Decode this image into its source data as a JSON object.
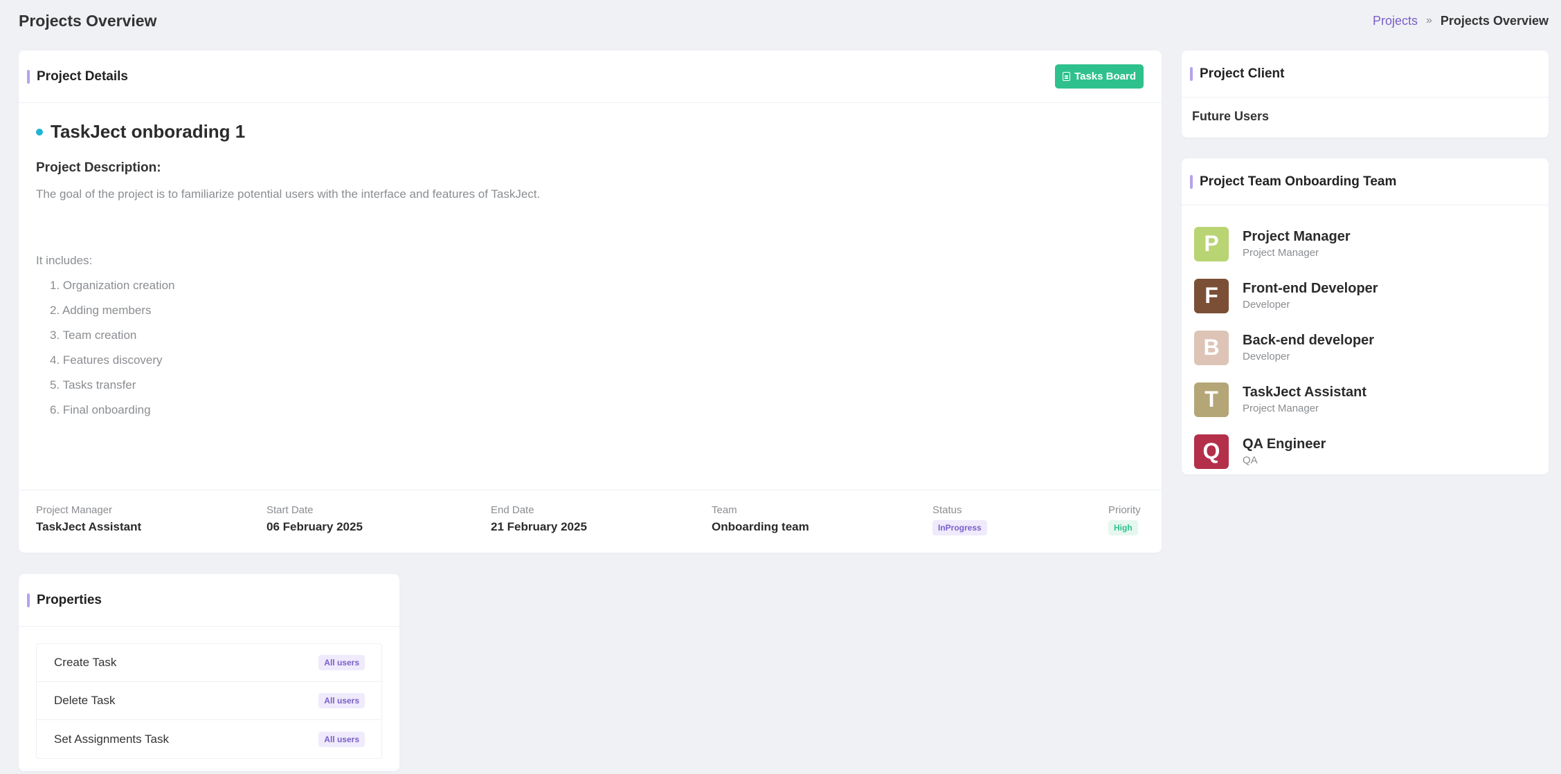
{
  "page": {
    "title": "Projects Overview"
  },
  "breadcrumb": {
    "link": "Projects",
    "separator": "»",
    "current": "Projects Overview"
  },
  "details": {
    "card_title": "Project Details",
    "tasks_board_label": "Tasks Board",
    "project_name": "TaskJect onborading 1",
    "description_label": "Project Description:",
    "description": "The goal of the project is to familiarize potential users with the interface and features of TaskJect.",
    "includes_label": "It includes:",
    "includes": [
      "1. Organization creation",
      "2. Adding members",
      "3. Team creation",
      "4. Features discovery",
      "5. Tasks transfer",
      "6. Final onboarding"
    ],
    "meta": {
      "manager_label": "Project Manager",
      "manager": "TaskJect Assistant",
      "start_label": "Start Date",
      "start": "06 February 2025",
      "end_label": "End Date",
      "end": "21 February 2025",
      "team_label": "Team",
      "team": "Onboarding team",
      "status_label": "Status",
      "status": "InProgress",
      "priority_label": "Priority",
      "priority": "High"
    }
  },
  "properties": {
    "card_title": "Properties",
    "rows": [
      {
        "name": "Create Task",
        "scope": "All users"
      },
      {
        "name": "Delete Task",
        "scope": "All users"
      },
      {
        "name": "Set Assignments Task",
        "scope": "All users"
      }
    ]
  },
  "client": {
    "card_title": "Project Client",
    "name": "Future Users"
  },
  "team": {
    "card_title": "Project Team Onboarding Team",
    "members": [
      {
        "initial": "P",
        "name": "Project Manager",
        "role": "Project Manager",
        "color": "#b9d472"
      },
      {
        "initial": "F",
        "name": "Front-end Developer",
        "role": "Developer",
        "color": "#7b4f36"
      },
      {
        "initial": "B",
        "name": "Back-end developer",
        "role": "Developer",
        "color": "#ddc4b6"
      },
      {
        "initial": "T",
        "name": "TaskJect Assistant",
        "role": "Project Manager",
        "color": "#b5a677"
      },
      {
        "initial": "Q",
        "name": "QA Engineer",
        "role": "QA",
        "color": "#b4304a"
      }
    ]
  },
  "colors": {
    "accent": "#7a5fc7",
    "success": "#2ec18d",
    "bullet": "#1fb6d4",
    "background": "#f0f1f5"
  }
}
